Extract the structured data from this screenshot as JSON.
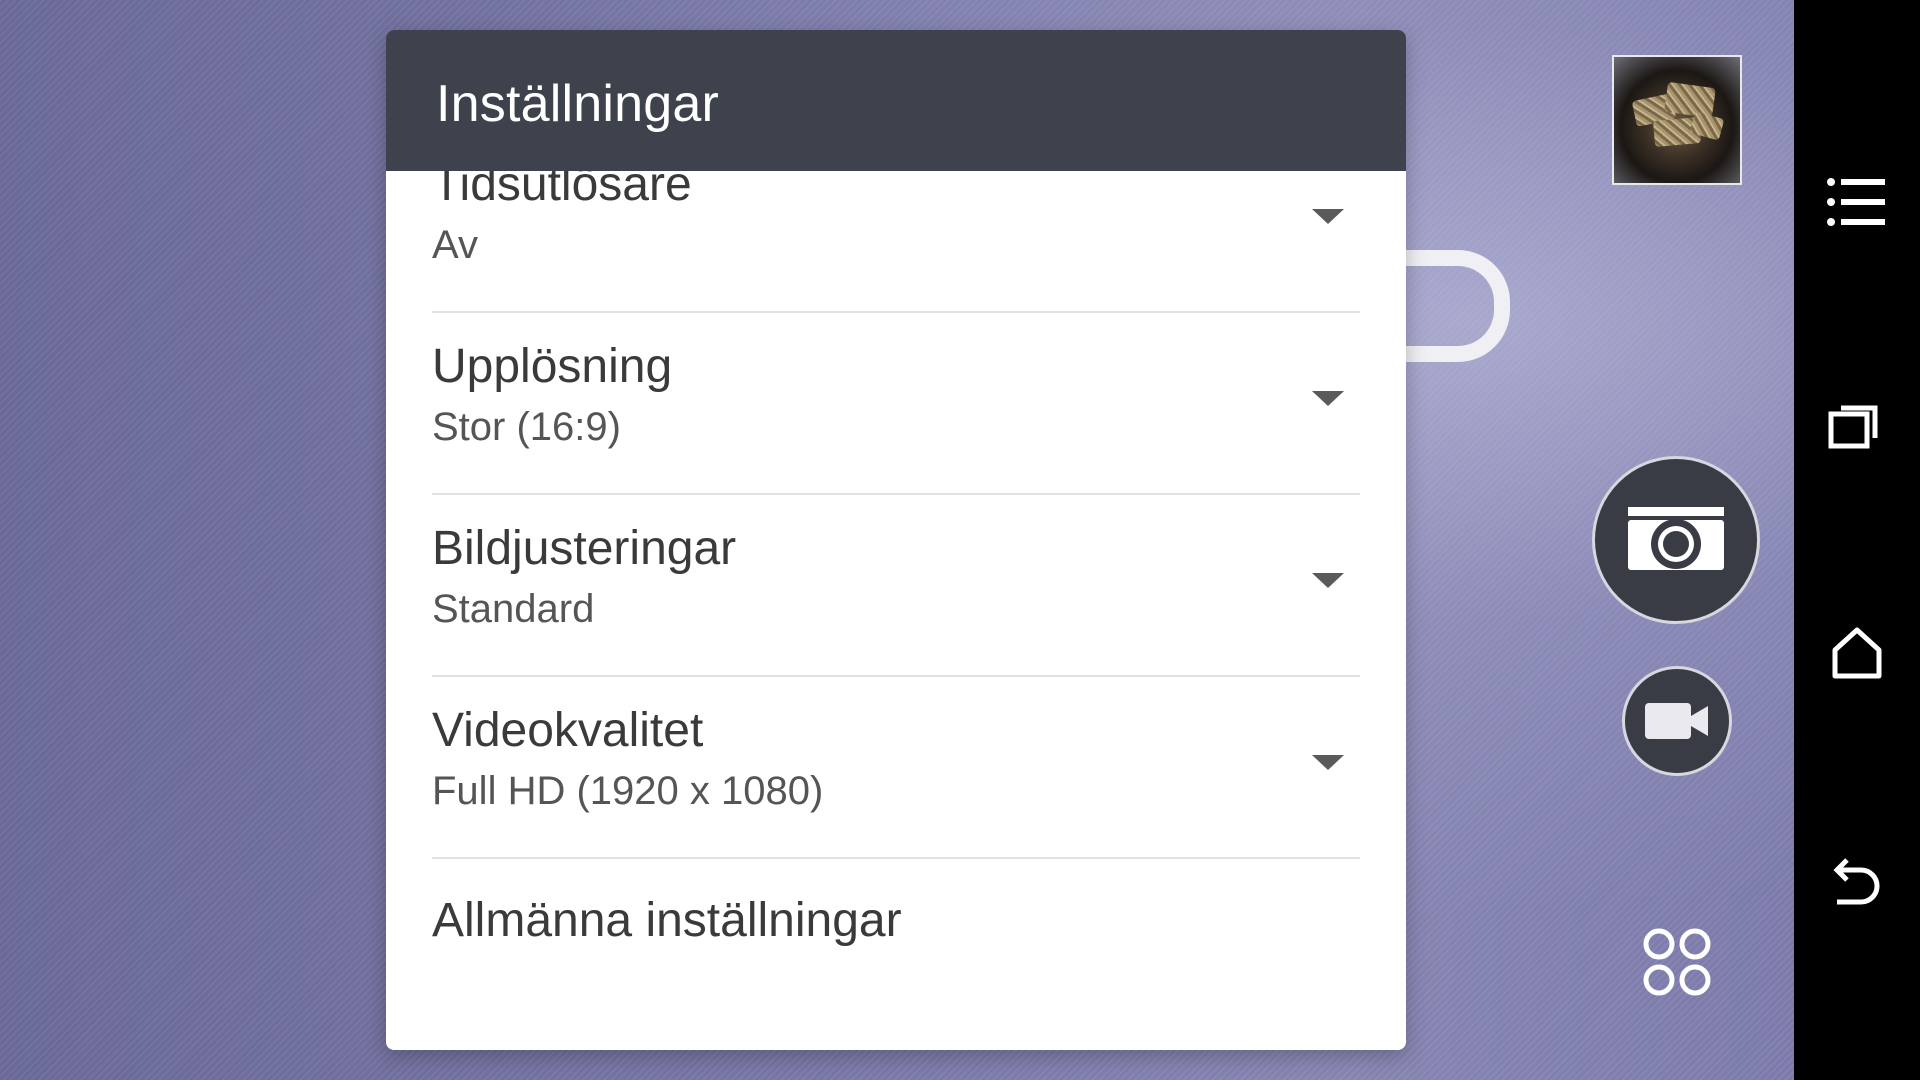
{
  "dialog": {
    "title": "Inställningar",
    "items": [
      {
        "title": "Tidsutlösare",
        "value": "Av"
      },
      {
        "title": "Upplösning",
        "value": "Stor (16:9)"
      },
      {
        "title": "Bildjusteringar",
        "value": "Standard"
      },
      {
        "title": "Videokvalitet",
        "value": "Full HD (1920 x 1080)"
      }
    ],
    "general_settings_label": "Allmänna inställningar"
  },
  "controls": {
    "thumbnail_icon": "gallery-thumbnail",
    "shutter_icon": "camera-icon",
    "video_icon": "video-camera-icon",
    "modes_icon": "grid-circles-icon"
  },
  "nav_bar": {
    "icons": [
      "menu-icon",
      "recent-apps-icon",
      "home-icon",
      "back-icon"
    ]
  },
  "colors": {
    "header": "#3d424c",
    "background": "#7b7aa9",
    "nav_bar": "#000000"
  }
}
